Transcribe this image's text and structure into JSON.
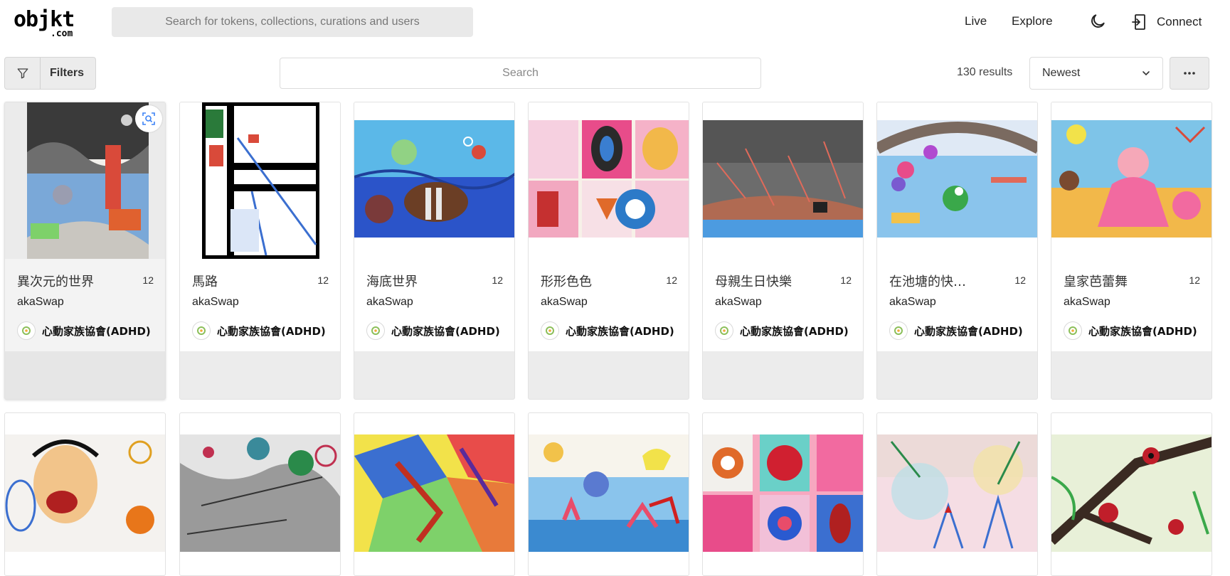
{
  "header": {
    "logo_main": "objkt",
    "logo_sub": ".com",
    "search_placeholder": "Search for tokens, collections, curations and users",
    "nav": {
      "live": "Live",
      "explore": "Explore"
    },
    "theme_icon": "moon-icon",
    "connect_label": "Connect",
    "connect_icon": "login-icon"
  },
  "toolbar": {
    "filters_label": "Filters",
    "filters_icon": "funnel-icon",
    "search_placeholder": "Search",
    "results": "130 results",
    "sort_value": "Newest",
    "more_icon": "ellipsis-icon"
  },
  "colors": {
    "accent": "#000000",
    "card_bg": "#ececec",
    "search_bg": "#e9e9e9"
  },
  "cards": [
    {
      "title": "異次元的世界",
      "edition": "12",
      "collection": "akaSwap",
      "creator": "心動家族協會(ADHD)"
    },
    {
      "title": "馬路",
      "edition": "12",
      "collection": "akaSwap",
      "creator": "心動家族協會(ADHD)"
    },
    {
      "title": "海底世界",
      "edition": "12",
      "collection": "akaSwap",
      "creator": "心動家族協會(ADHD)"
    },
    {
      "title": "形形色色",
      "edition": "12",
      "collection": "akaSwap",
      "creator": "心動家族協會(ADHD)"
    },
    {
      "title": "母親生日快樂",
      "edition": "12",
      "collection": "akaSwap",
      "creator": "心動家族協會(ADHD)"
    },
    {
      "title": "在池塘的快樂時光",
      "edition": "12",
      "collection": "akaSwap",
      "creator": "心動家族協會(ADHD)"
    },
    {
      "title": "皇家芭蕾舞",
      "edition": "12",
      "collection": "akaSwap",
      "creator": "心動家族協會(ADHD)"
    }
  ],
  "row2_count": 7
}
